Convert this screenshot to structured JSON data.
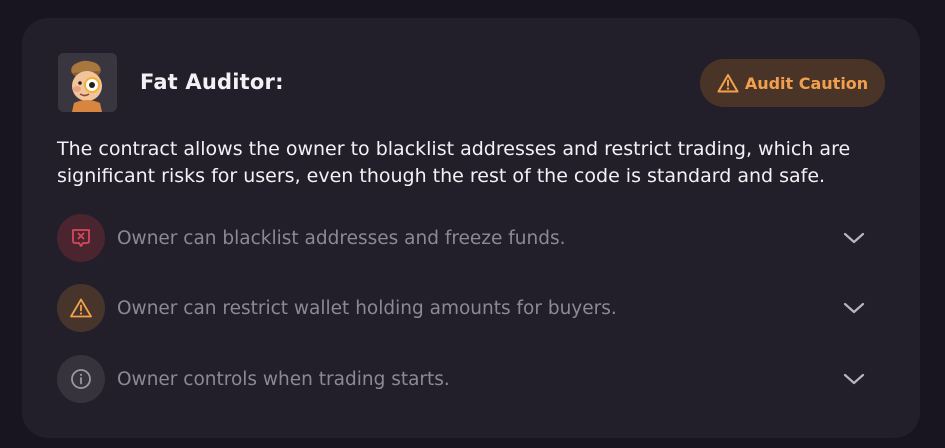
{
  "auditor": {
    "title": "Fat Auditor:",
    "avatar_icon": "fat-auditor-avatar"
  },
  "badge": {
    "label": "Audit Caution",
    "icon": "warning-triangle-icon",
    "color": "#f2a04d",
    "background": "#4a3428"
  },
  "description": "The contract allows the owner to blacklist addresses and restrict trading, which are significant risks for users, even though the rest of the code is standard and safe.",
  "risks": [
    {
      "label": "Owner can blacklist addresses and freeze funds.",
      "icon": "blocked-shield-icon",
      "severity": "high",
      "color": "#d9475a"
    },
    {
      "label": "Owner can restrict wallet holding amounts for buyers.",
      "icon": "warning-triangle-icon",
      "severity": "medium",
      "color": "#f2a04d"
    },
    {
      "label": "Owner controls when trading starts.",
      "icon": "info-icon",
      "severity": "info",
      "color": "#9a97a3"
    }
  ]
}
